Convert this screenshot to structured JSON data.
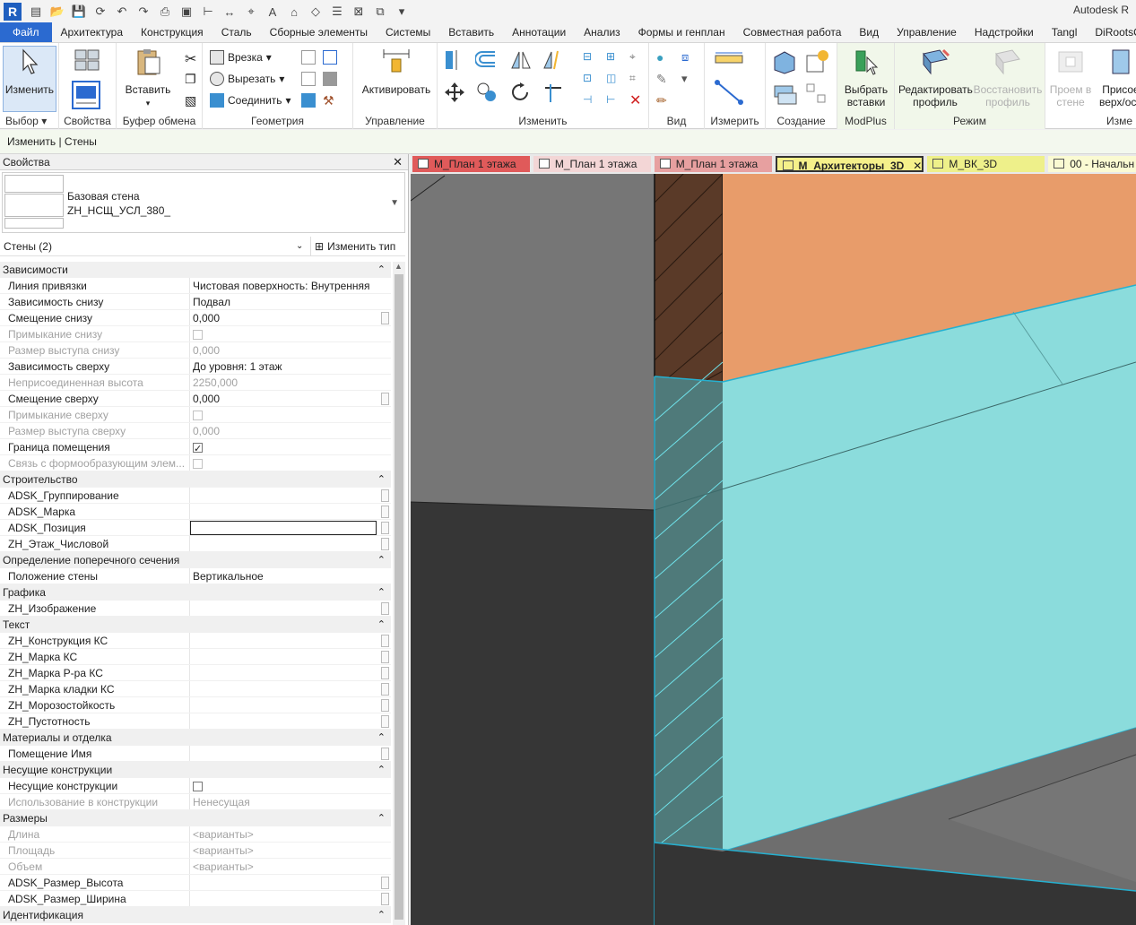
{
  "app": {
    "logo": "R",
    "title": "Autodesk R"
  },
  "quick_access": {
    "icons": [
      "open-icon",
      "save-icon",
      "sync-icon",
      "undo-icon",
      "redo-icon",
      "print-icon",
      "measure-icon",
      "dimension-icon",
      "tag-icon",
      "text-icon",
      "home-3d-icon",
      "section-icon",
      "thin-lines-icon",
      "close-views-icon",
      "switch-windows-icon",
      "customize-icon"
    ]
  },
  "tabs": [
    {
      "label": "Файл"
    },
    {
      "label": "Архитектура"
    },
    {
      "label": "Конструкция"
    },
    {
      "label": "Сталь"
    },
    {
      "label": "Сборные элементы"
    },
    {
      "label": "Системы"
    },
    {
      "label": "Вставить"
    },
    {
      "label": "Аннотации"
    },
    {
      "label": "Анализ"
    },
    {
      "label": "Формы и генплан"
    },
    {
      "label": "Совместная работа"
    },
    {
      "label": "Вид"
    },
    {
      "label": "Управление"
    },
    {
      "label": "Надстройки"
    },
    {
      "label": "Tangl"
    },
    {
      "label": "DiRootsOne"
    }
  ],
  "ribbon": {
    "select": {
      "modify": "Изменить",
      "label": "Выбор"
    },
    "properties": {
      "label": "Свойства"
    },
    "clipboard": {
      "paste": "Вставить",
      "label": "Буфер обмена"
    },
    "geometry": {
      "cope": "Врезка",
      "cut": "Вырезать",
      "join": "Соединить",
      "label": "Геометрия"
    },
    "control": {
      "activate": "Активировать",
      "label": "Управление"
    },
    "modify": {
      "label": "Изменить"
    },
    "view": {
      "label": "Вид"
    },
    "measure": {
      "label": "Измерить"
    },
    "create": {
      "label": "Создание"
    },
    "modplus": {
      "select_inserts": "Выбрать вставки",
      "label": "ModPlus"
    },
    "mode": {
      "edit_profile": "Редактировать профиль",
      "reset_profile": "Восстановить профиль",
      "label": "Режим"
    },
    "opening": {
      "wall_opening": "Проем в стене",
      "attach": "Присое верх/осн",
      "label": "Изме"
    }
  },
  "context_bar": "Изменить | Стены",
  "properties": {
    "header": "Свойства",
    "type_family": "Базовая стена",
    "type_name": "ZH_НСЩ_УСЛ_380_",
    "instance_filter": "Стены (2)",
    "edit_type": "Изменить тип",
    "groups": [
      {
        "name": "Зависимости",
        "rows": [
          {
            "key": "Линия привязки",
            "value": "Чистовая поверхность: Внутренняя"
          },
          {
            "key": "Зависимость снизу",
            "value": "Подвал"
          },
          {
            "key": "Смещение снизу",
            "value": "0,000",
            "btn": true
          },
          {
            "key": "Примыкание снизу",
            "value": "",
            "checkbox": "off",
            "disabled": true
          },
          {
            "key": "Размер выступа снизу",
            "value": "0,000",
            "disabled": true
          },
          {
            "key": "Зависимость сверху",
            "value": "До уровня: 1 этаж"
          },
          {
            "key": "Неприсоединенная высота",
            "value": "2250,000",
            "disabled": true
          },
          {
            "key": "Смещение сверху",
            "value": "0,000",
            "btn": true
          },
          {
            "key": "Примыкание сверху",
            "value": "",
            "checkbox": "off",
            "disabled": true
          },
          {
            "key": "Размер выступа сверху",
            "value": "0,000",
            "disabled": true
          },
          {
            "key": "Граница помещения",
            "value": "",
            "checkbox": "on"
          },
          {
            "key": "Связь с формообразующим элем...",
            "value": "",
            "checkbox": "off",
            "disabled": true
          }
        ]
      },
      {
        "name": "Строительство",
        "rows": [
          {
            "key": "ADSK_Группирование",
            "value": "",
            "btn": true
          },
          {
            "key": "ADSK_Марка",
            "value": "",
            "btn": true
          },
          {
            "key": "ADSK_Позиция",
            "value": "",
            "btn": true,
            "editing": true
          },
          {
            "key": "ZH_Этаж_Числовой",
            "value": "",
            "btn": true
          }
        ]
      },
      {
        "name": "Определение поперечного сечения",
        "rows": [
          {
            "key": "Положение стены",
            "value": "Вертикальное"
          }
        ]
      },
      {
        "name": "Графика",
        "rows": [
          {
            "key": "ZH_Изображение",
            "value": "",
            "btn": true
          }
        ]
      },
      {
        "name": "Текст",
        "rows": [
          {
            "key": "ZH_Конструкция КС",
            "value": "",
            "btn": true
          },
          {
            "key": "ZH_Марка КС",
            "value": "",
            "btn": true
          },
          {
            "key": "ZH_Марка Р-ра КС",
            "value": "",
            "btn": true
          },
          {
            "key": "ZH_Марка кладки КС",
            "value": "",
            "btn": true
          },
          {
            "key": "ZH_Морозостойкость",
            "value": "",
            "btn": true
          },
          {
            "key": "ZH_Пустотность",
            "value": "",
            "btn": true
          }
        ]
      },
      {
        "name": "Материалы и отделка",
        "rows": [
          {
            "key": "Помещение Имя",
            "value": "",
            "btn": true
          }
        ]
      },
      {
        "name": "Несущие конструкции",
        "rows": [
          {
            "key": "Несущие конструкции",
            "value": "",
            "checkbox": "off"
          },
          {
            "key": "Использование в конструкции",
            "value": "Ненесущая",
            "disabled": true
          }
        ]
      },
      {
        "name": "Размеры",
        "rows": [
          {
            "key": "Длина",
            "value": "<варианты>",
            "disabled": true
          },
          {
            "key": "Площадь",
            "value": "<варианты>",
            "disabled": true
          },
          {
            "key": "Объем",
            "value": "<варианты>",
            "disabled": true
          },
          {
            "key": "ADSK_Размер_Высота",
            "value": "",
            "btn": true
          },
          {
            "key": "ADSK_Размер_Ширина",
            "value": "",
            "btn": true
          }
        ]
      },
      {
        "name": "Идентификация",
        "rows": []
      }
    ]
  },
  "view_tabs": [
    {
      "label": "М_План 1 этажа",
      "color": "#e05a5a",
      "active": false
    },
    {
      "label": "М_План 1 этажа",
      "color": "#f3d6d6",
      "active": false
    },
    {
      "label": "М_План 1 этажа",
      "color": "#e7a0a0",
      "active": false
    },
    {
      "label": "М_Архитекторы_3D",
      "color": "#f5f08a",
      "active": true
    },
    {
      "label": "М_ВК_3D",
      "color": "#eef08a",
      "active": false
    },
    {
      "label": "00 - Начальн",
      "color": "#fafad2",
      "active": false
    }
  ],
  "colors": {
    "accent": "#2b6ad0",
    "selection": "#8bdcdc",
    "wall_orange": "#e89c6a",
    "wall_brown": "#5a3a28",
    "floor_dark": "#383838"
  }
}
